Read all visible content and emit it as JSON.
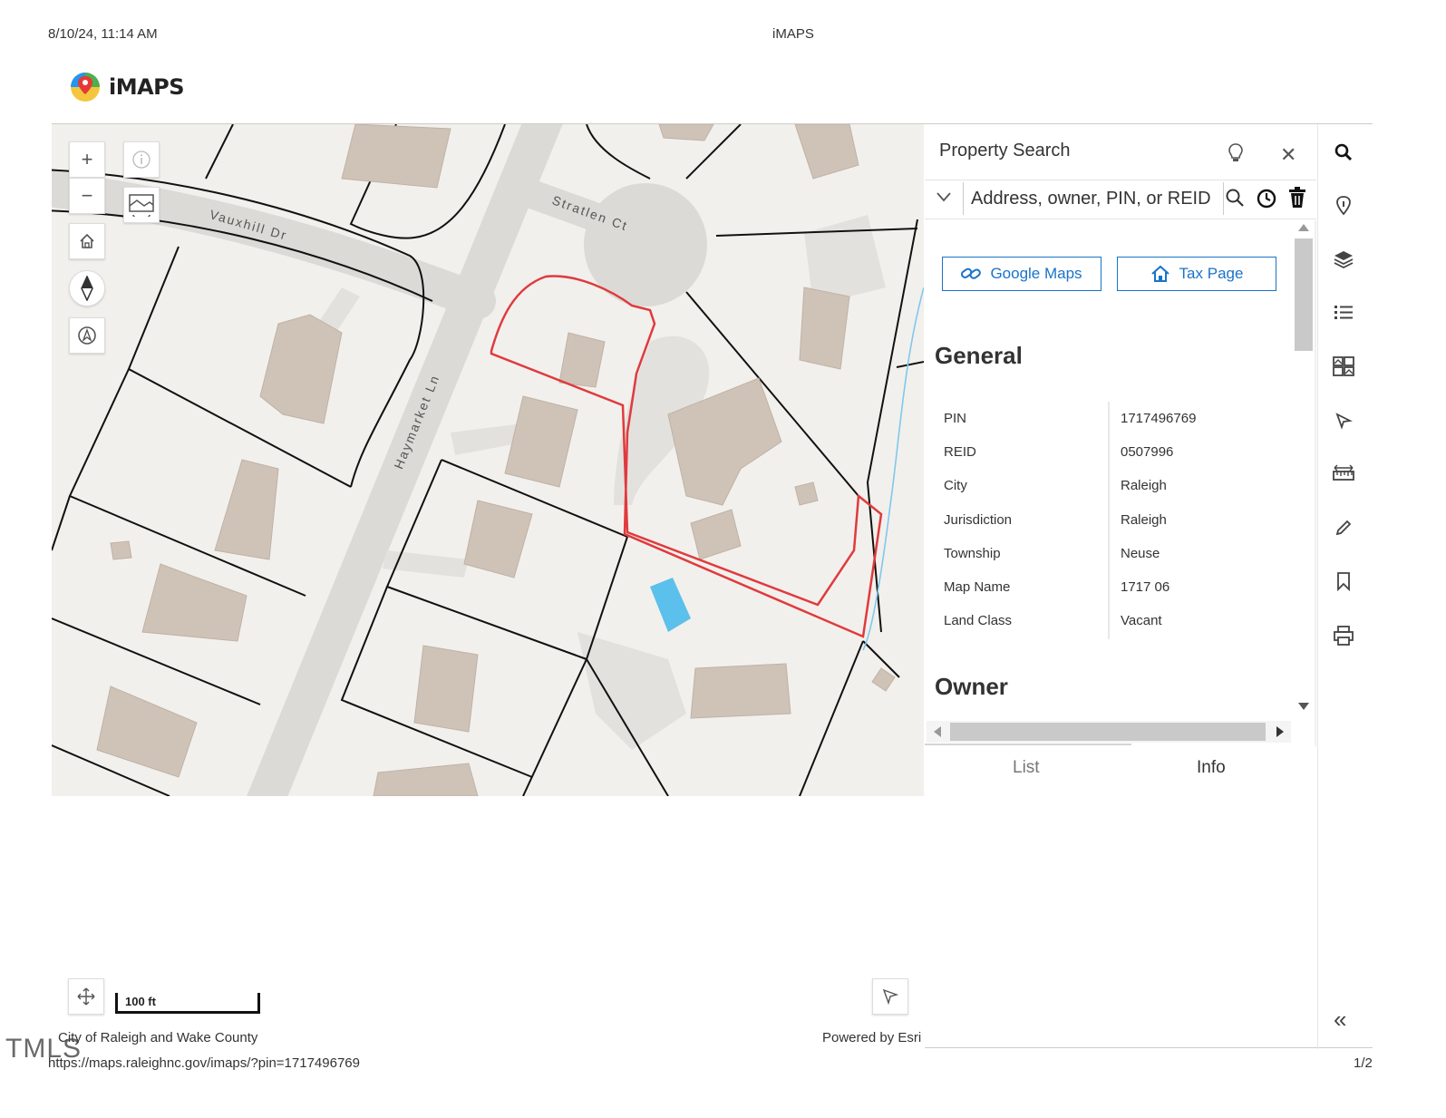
{
  "print_header": {
    "datetime": "8/10/24, 11:14 AM",
    "title": "iMAPS"
  },
  "app": {
    "logo_text": "iMAPS"
  },
  "map": {
    "streets": [
      "Vauxhill Dr",
      "Stratlen Ct",
      "Haymarket Ln"
    ],
    "controls": {
      "zoom_in": "+",
      "zoom_out": "−"
    },
    "scale_label": "100 ft",
    "attribution_left": "City of Raleigh and Wake County",
    "attribution_right": "Powered by Esri",
    "colors": {
      "background": "#f2f0ec",
      "building": "#cfc3b8",
      "parcel_line": "#111111",
      "selected_parcel": "#e03a3e",
      "pool": "#5bc0eb",
      "stream": "#7fc8ee"
    }
  },
  "panel": {
    "title": "Property Search",
    "search_placeholder": "Address, owner, PIN, or REID",
    "buttons": {
      "google_maps": "Google Maps",
      "tax_page": "Tax Page"
    },
    "general": {
      "heading": "General",
      "rows": [
        {
          "label": "PIN",
          "value": "1717496769"
        },
        {
          "label": "REID",
          "value": "0507996"
        },
        {
          "label": "City",
          "value": "Raleigh"
        },
        {
          "label": "Jurisdiction",
          "value": "Raleigh"
        },
        {
          "label": "Township",
          "value": "Neuse"
        },
        {
          "label": "Map Name",
          "value": "1717 06"
        },
        {
          "label": "Land Class",
          "value": "Vacant"
        }
      ]
    },
    "owner_heading": "Owner",
    "tabs": {
      "list": "List",
      "info": "Info"
    },
    "accent": "#1a73c8"
  },
  "sidebar": {
    "icons": [
      "search-icon",
      "identify-icon",
      "layers-icon",
      "legend-icon",
      "basemap-icon",
      "select-icon",
      "measure-icon",
      "draw-icon",
      "bookmark-icon",
      "print-icon"
    ],
    "collapse": "«"
  },
  "print_footer": {
    "url": "https://maps.raleighnc.gov/imaps/?pin=1717496769",
    "page": "1/2",
    "watermark": "TMLS"
  }
}
